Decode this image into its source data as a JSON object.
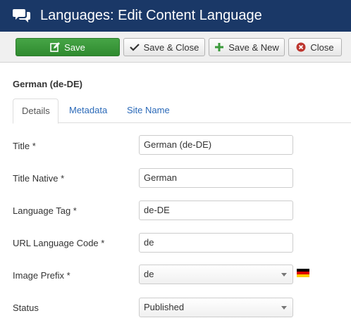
{
  "header": {
    "title": "Languages: Edit Content Language",
    "icon": "comments-icon"
  },
  "toolbar": {
    "save_label": "Save",
    "save_close_label": "Save & Close",
    "save_new_label": "Save & New",
    "close_label": "Close"
  },
  "language_heading": "German (de-DE)",
  "tabs": [
    {
      "label": "Details",
      "active": true
    },
    {
      "label": "Metadata",
      "active": false
    },
    {
      "label": "Site Name",
      "active": false
    }
  ],
  "form": {
    "title": {
      "label": "Title *",
      "value": "German (de-DE)"
    },
    "title_native": {
      "label": "Title Native *",
      "value": "German"
    },
    "language_tag": {
      "label": "Language Tag *",
      "value": "de-DE"
    },
    "url_code": {
      "label": "URL Language Code *",
      "value": "de"
    },
    "image_prefix": {
      "label": "Image Prefix *",
      "value": "de",
      "flag": "german-flag-icon"
    },
    "status": {
      "label": "Status",
      "value": "Published"
    }
  },
  "colors": {
    "header_bg": "#1a3867",
    "save_green": "#46a546",
    "link_blue": "#2a69b8",
    "close_red": "#bd362f"
  }
}
